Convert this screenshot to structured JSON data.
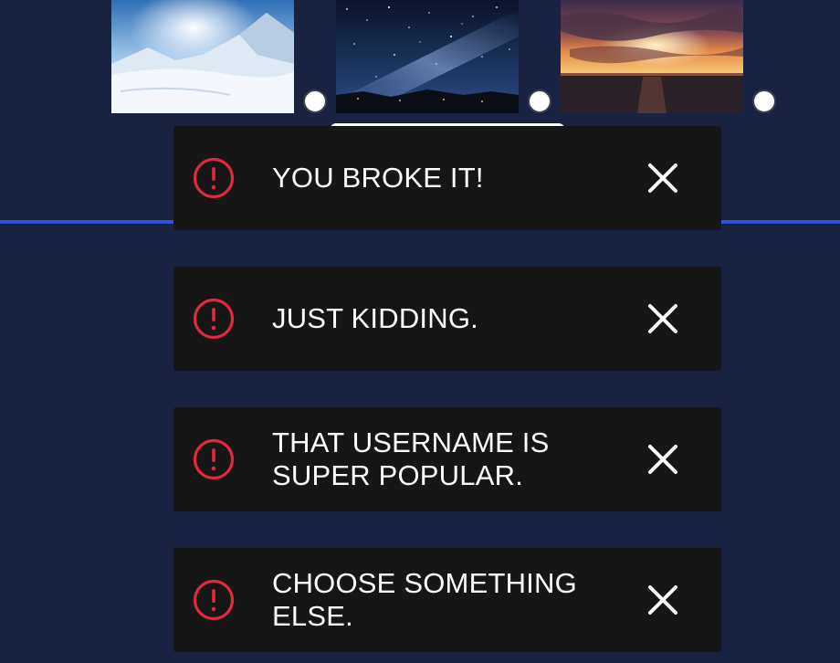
{
  "image_picker": {
    "images": [
      {
        "icon": "snowy-mountain-image",
        "selected": false
      },
      {
        "icon": "starry-night-image",
        "selected": false
      },
      {
        "icon": "sunset-ocean-image",
        "selected": false
      }
    ]
  },
  "colors": {
    "background": "#192240",
    "toast_background": "#161616",
    "alert_icon": "#e0283e",
    "divider": "#2f52d6",
    "text": "#ffffff"
  },
  "toasts": [
    {
      "message": "YOU BROKE IT!",
      "icon": "alert-circle-icon",
      "close_icon": "close-icon"
    },
    {
      "message": "JUST KIDDING.",
      "icon": "alert-circle-icon",
      "close_icon": "close-icon"
    },
    {
      "message": "THAT USERNAME IS SUPER POPULAR.",
      "icon": "alert-circle-icon",
      "close_icon": "close-icon"
    },
    {
      "message": "CHOOSE SOMETHING ELSE.",
      "icon": "alert-circle-icon",
      "close_icon": "close-icon"
    }
  ]
}
